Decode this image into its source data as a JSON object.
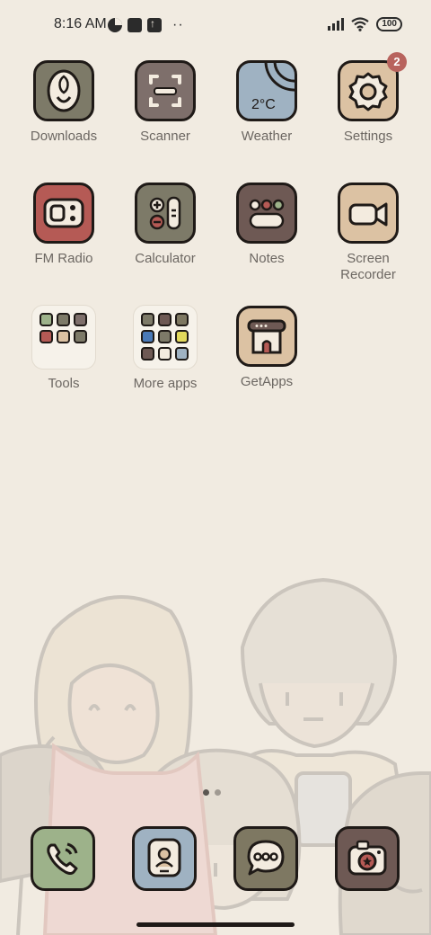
{
  "status_bar": {
    "time": "8:16 AM",
    "battery": "100",
    "icons": [
      "data-saver-icon",
      "square-notification-icon",
      "upload-icon",
      "more-dots-icon",
      "signal-icon",
      "wifi-icon",
      "battery-icon"
    ]
  },
  "apps": [
    {
      "label": "Downloads",
      "icon": "download-icon",
      "color": "#7d7a68"
    },
    {
      "label": "Scanner",
      "icon": "scanner-icon",
      "color": "#7e6f6b"
    },
    {
      "label": "Weather",
      "icon": "weather-icon",
      "color": "#9fb2c2",
      "temp": "2°C"
    },
    {
      "label": "Settings",
      "icon": "gear-icon",
      "color": "#dcc2a3",
      "badge": "2"
    },
    {
      "label": "FM Radio",
      "icon": "radio-icon",
      "color": "#b55a55"
    },
    {
      "label": "Calculator",
      "icon": "calculator-icon",
      "color": "#7d7a68"
    },
    {
      "label": "Notes",
      "icon": "notes-icon",
      "color": "#6e5954"
    },
    {
      "label": "Screen\nRecorder",
      "icon": "video-camera-icon",
      "color": "#dcc2a3"
    },
    {
      "label": "Tools",
      "icon": "folder-icon"
    },
    {
      "label": "More apps",
      "icon": "folder-icon"
    },
    {
      "label": "GetApps",
      "icon": "getapps-icon",
      "color": "#dcc2a3"
    }
  ],
  "dock": [
    {
      "name": "phone",
      "icon": "phone-icon",
      "color": "#9db28a"
    },
    {
      "name": "contacts",
      "icon": "contacts-icon",
      "color": "#9fb2c2"
    },
    {
      "name": "messages",
      "icon": "message-icon",
      "color": "#7e7862"
    },
    {
      "name": "camera",
      "icon": "camera-icon",
      "color": "#6e5954"
    }
  ]
}
